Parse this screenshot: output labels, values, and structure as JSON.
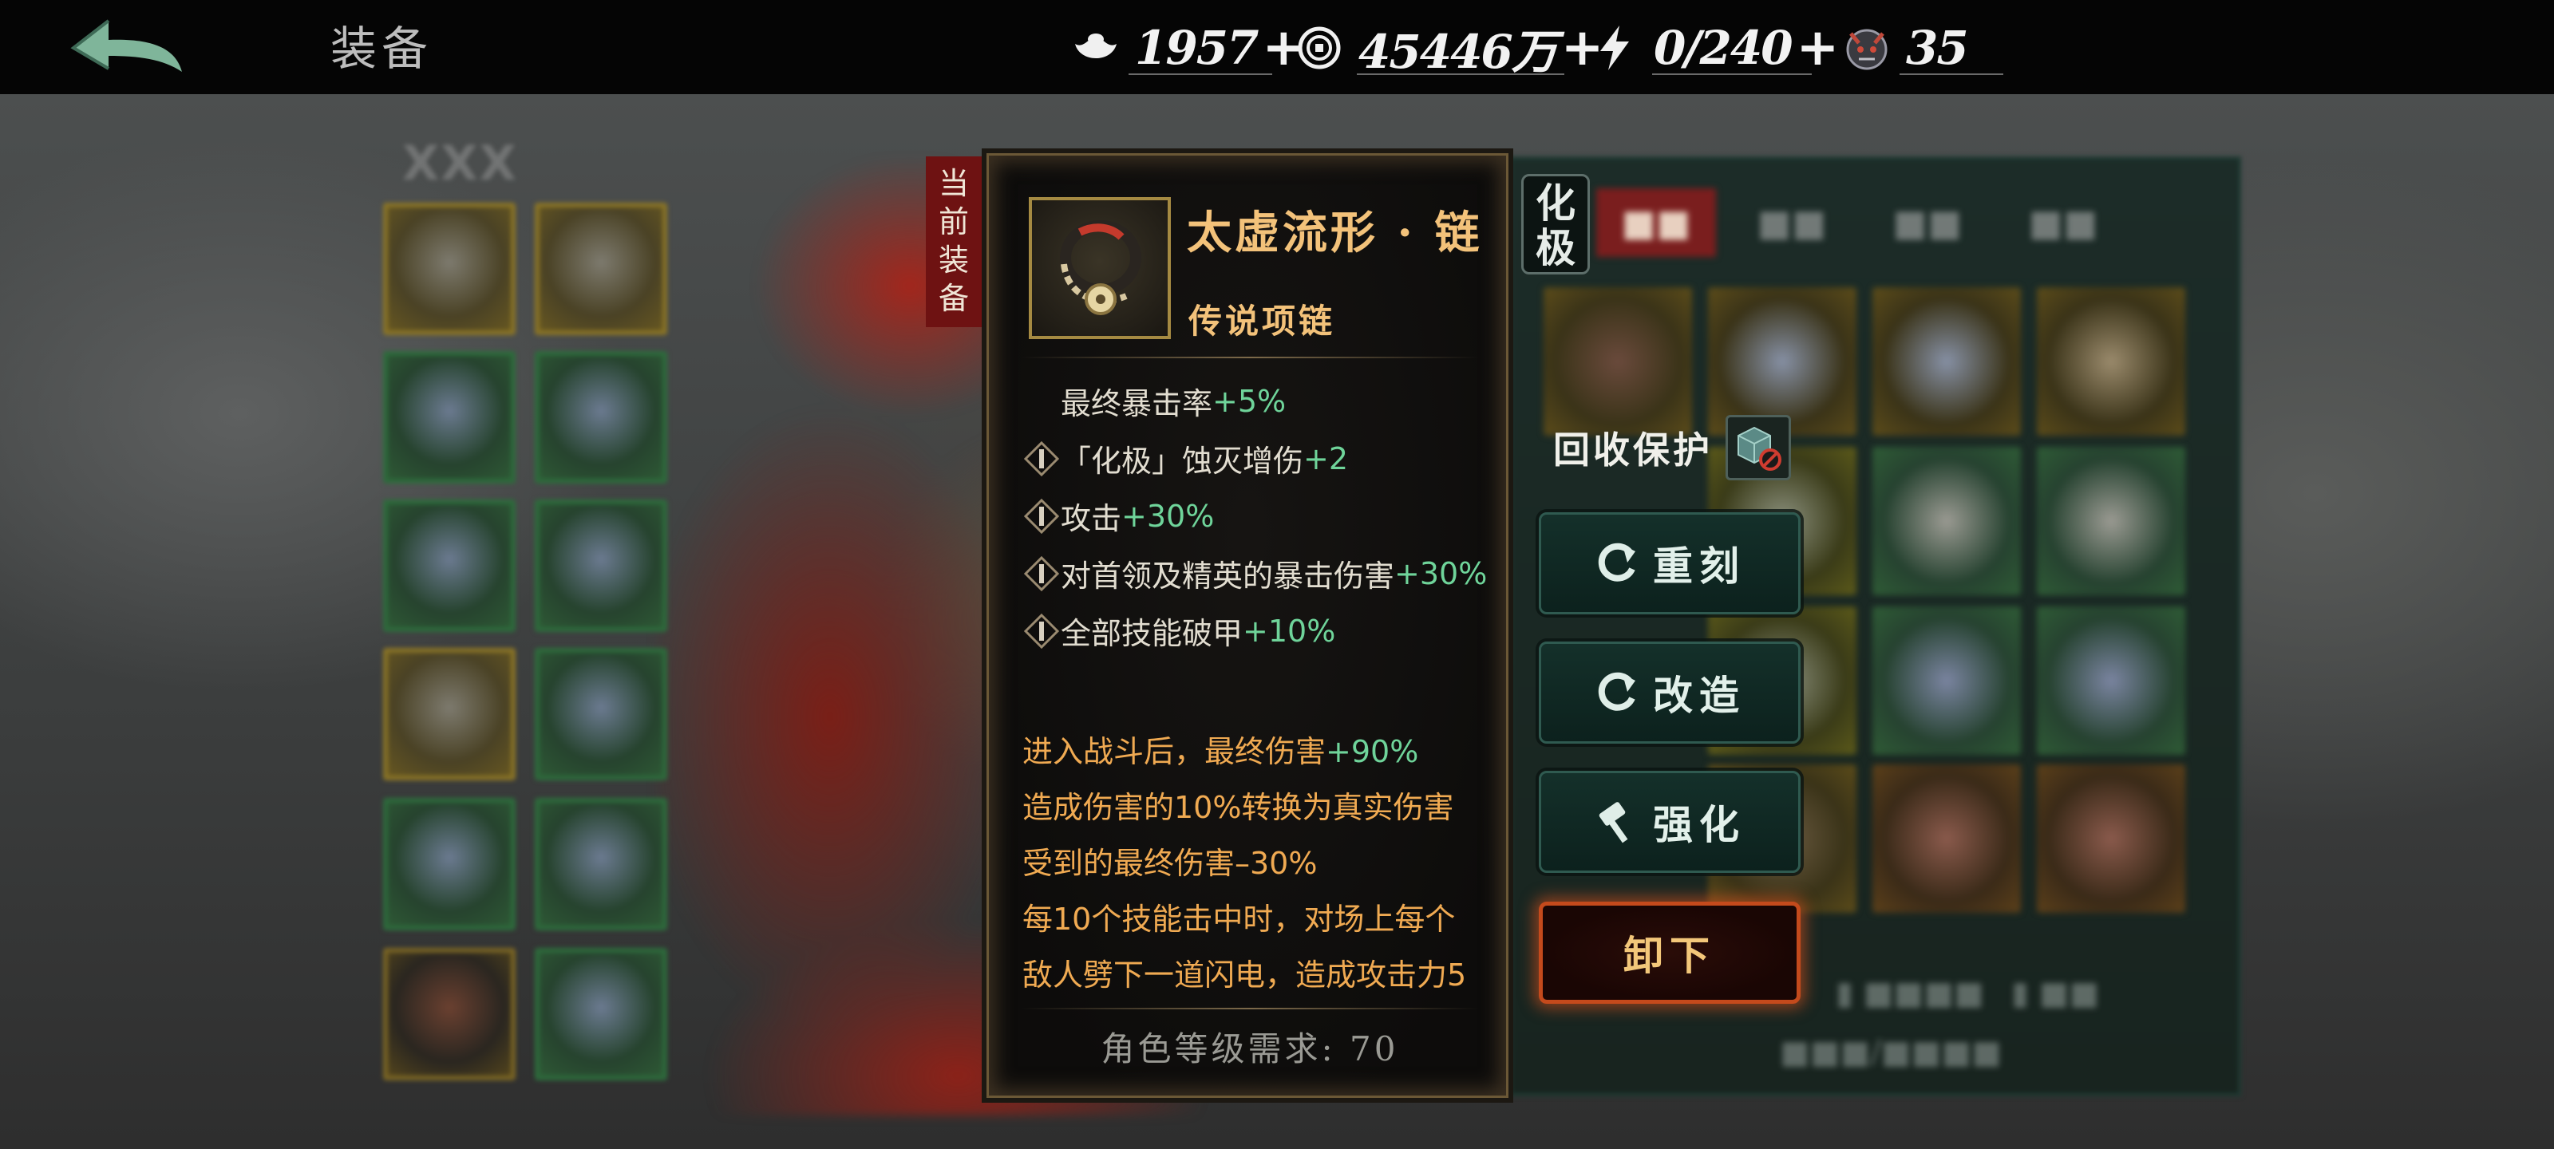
{
  "header": {
    "title": "装备",
    "resources": [
      {
        "icon": "silver-ingot-icon",
        "value": "1957"
      },
      {
        "icon": "coin-icon",
        "value": "45446万"
      },
      {
        "icon": "lightning-icon",
        "value": "0/240"
      },
      {
        "icon": "demon-mask-icon",
        "value": "35"
      }
    ]
  },
  "current_equip_label": "当前装备",
  "item": {
    "name": "太虚流形 · 链",
    "type": "传说项链",
    "stats": [
      {
        "label": "最终暴击率",
        "value": "+5%",
        "rune": false
      },
      {
        "label": "「化极」蚀灭增伤",
        "value": "+2",
        "rune": true
      },
      {
        "label": "攻击",
        "value": "+30%",
        "rune": true
      },
      {
        "label": "对首领及精英的暴击伤害",
        "value": "+30%",
        "rune": true
      },
      {
        "label": "全部技能破甲",
        "value": "+10%",
        "rune": true
      }
    ],
    "skill_lines": [
      {
        "text": "进入战斗后，最终伤害",
        "value": "+90%"
      },
      {
        "text": "造成伤害的10%转换为真实伤害",
        "value": ""
      },
      {
        "text": "受到的最终伤害–30%",
        "value": ""
      },
      {
        "text": "每10个技能击中时，对场上每个",
        "value": ""
      },
      {
        "text": "敌人劈下一道闪电，造成攻击力5",
        "value": ""
      }
    ],
    "requirement": "角色等级需求: 70"
  },
  "huaji_badge": "化极",
  "recycle_protect_label": "回收保护",
  "actions": {
    "reforge": "重刻",
    "modify": "改造",
    "enhance": "强化",
    "unequip": "卸下"
  },
  "colors": {
    "item_name": "#f3c27a",
    "stat_bonus": "#6fd49a",
    "skill_text": "#f0aa52",
    "unequip_border": "#c44a1c"
  }
}
